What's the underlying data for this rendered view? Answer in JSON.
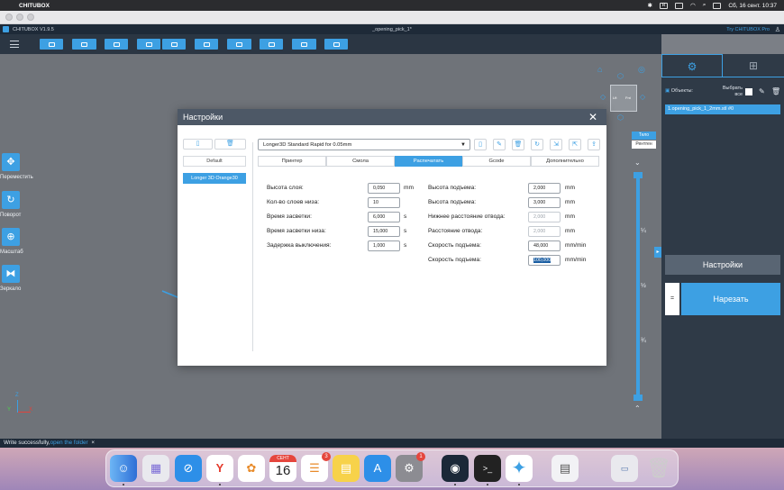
{
  "menubar": {
    "app_name": "CHITUBOX",
    "clock": "Сб, 16 сент.  10:37"
  },
  "app": {
    "version": "CHITUBOX V1.9.5",
    "doc_title": "_opening_pick_1*",
    "try_pro": "Try CHITUBOX Pro"
  },
  "left_tools": {
    "move": "Переместить",
    "rotate": "Поворот",
    "scale": "Масштаб",
    "mirror": "Зеркало"
  },
  "view": {
    "xray": "Тело",
    "xray2": "Рентген",
    "cube_left": "Lft",
    "cube_right": "Fnt",
    "slider_labels": [
      "¼",
      "½",
      "¾"
    ],
    "axis_z": "Z",
    "axis_y": "Y",
    "axis_x": "X"
  },
  "right_panel": {
    "objects_label": "Объекты:",
    "select_all": "Выбрать все",
    "object_item": "1.opening_pick_1_2mm.stl #0",
    "settings_btn": "Настройки",
    "slice_btn": "Нарезать",
    "small_btn": "="
  },
  "dialog": {
    "title": "Настройки",
    "default_label": "Default",
    "profile": "Longer 3D Orange30",
    "preset": "Longer3D Standard Rapid for 0.05mm",
    "tabs": [
      "Принтер",
      "Смола",
      "Распечатать",
      "Gcode",
      "Дополнительно"
    ],
    "active_tab": 2,
    "left_fields": [
      {
        "label": "Высота слоя:",
        "value": "0,050",
        "unit": "mm"
      },
      {
        "label": "Кол-во слоев низа:",
        "value": "10",
        "unit": ""
      },
      {
        "label": "Время засветки:",
        "value": "6,000",
        "unit": "s"
      },
      {
        "label": "Время засветки низа:",
        "value": "15,000",
        "unit": "s"
      },
      {
        "label": "Задержка выключения:",
        "value": "1,000",
        "unit": "s"
      }
    ],
    "right_fields": [
      {
        "label": "Высота подъема:",
        "value": "2,000",
        "unit": "mm"
      },
      {
        "label": "Высота подъема:",
        "value": "3,000",
        "unit": "mm"
      },
      {
        "label": "Нижнее расстояние отвода:",
        "value": "2,000",
        "unit": "mm"
      },
      {
        "label": "Расстояние отвода:",
        "value": "2,000",
        "unit": "mm"
      },
      {
        "label": "Скорость подъема:",
        "value": "48,000",
        "unit": "mm/min"
      },
      {
        "label": "Скорость подъема:",
        "value": "100,000",
        "unit": "mm/min"
      }
    ]
  },
  "status": {
    "text": "Write successfully,",
    "link": "open the folder",
    "close": "×"
  },
  "dock": {
    "calendar_month": "СЕНТ",
    "calendar_day": "16",
    "reminders_badge": "3",
    "settings_badge": "1"
  },
  "colors": {
    "accent": "#3da0e3",
    "panel": "#2f3a47",
    "viewport": "#6f7379"
  }
}
